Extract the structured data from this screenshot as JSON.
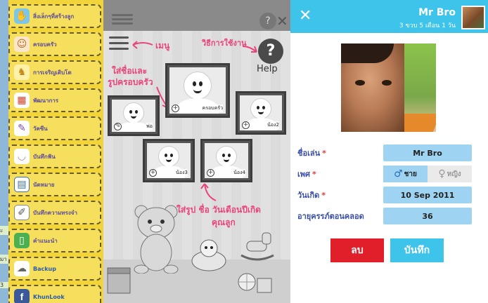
{
  "menu": {
    "items": [
      {
        "label": "สิ่งเล็กๆที่สร้างลูก",
        "icon": "hand-icon"
      },
      {
        "label": "ครอบครัว",
        "icon": "family-icon"
      },
      {
        "label": "การเจริญเติบโต",
        "icon": "giraffe-icon"
      },
      {
        "label": "พัฒนาการ",
        "icon": "blocks-icon"
      },
      {
        "label": "วัคซีน",
        "icon": "syringe-icon"
      },
      {
        "label": "บันทึกฟัน",
        "icon": "tooth-icon"
      },
      {
        "label": "นัดหมาย",
        "icon": "calendar-icon"
      },
      {
        "label": "บันทึกความทรงจำ",
        "icon": "notebook-icon"
      },
      {
        "label": "คำแนะนำ",
        "icon": "book-icon"
      },
      {
        "label": "Backup",
        "icon": "cloud-icon"
      },
      {
        "label": "KhunLook",
        "icon": "facebook-icon"
      }
    ],
    "strip_labels": [
      "ะ",
      "มา",
      "3"
    ]
  },
  "tutorial": {
    "menu_hint": "เมนู",
    "howto_hint": "วิธีการใช้งาน",
    "add_family_hint_1": "ใส่ชื่อและ",
    "add_family_hint_2": "รูปครอบครัว",
    "help_label": "Help",
    "help_symbol": "?",
    "add_child_hint_1": "ใส่รูป ชื่อ วันเดือนปีเกิด",
    "add_child_hint_2": "คุณลูก",
    "frames": {
      "family": "ครอบครัว",
      "dad": "พ่อ",
      "child2": "น้อง2",
      "child3": "น้อง3",
      "child4": "น้อง4"
    }
  },
  "profile": {
    "header_name": "Mr Bro",
    "header_age": "3 ขวบ 5 เดือน 1 วัน",
    "close_symbol": "✕",
    "fields": {
      "nickname_label": "ชื่อเล่น",
      "nickname_value": "Mr Bro",
      "gender_label": "เพศ",
      "gender_male": "ชาย",
      "gender_female": "หญิง",
      "birthday_label": "วันเกิด",
      "birthday_value": "10 Sep 2011",
      "gest_label": "อายุครรภ์ตอนคลอด",
      "gest_value": "36",
      "required_mark": "*"
    },
    "delete_label": "ลบ",
    "save_label": "บันทึก",
    "accent_color": "#3ec3ea",
    "delete_color": "#e01f2a"
  }
}
